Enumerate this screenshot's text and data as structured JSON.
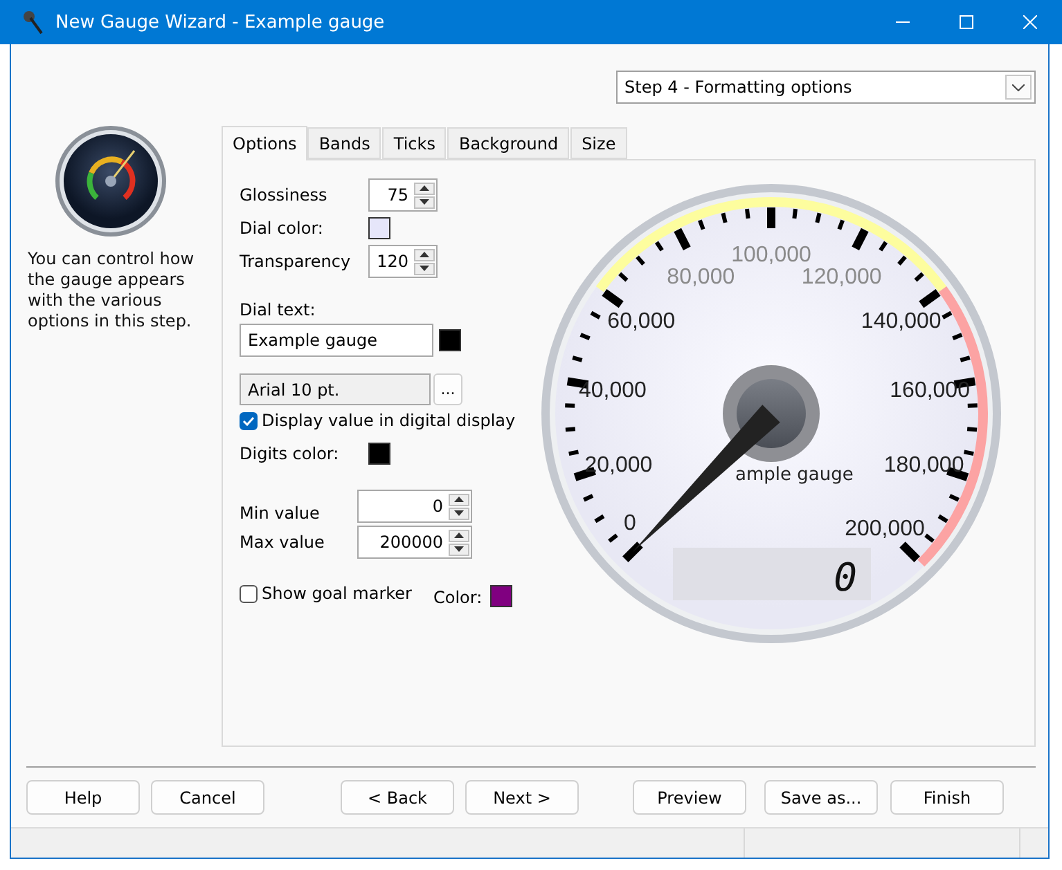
{
  "window": {
    "title": "New Gauge Wizard - Example gauge"
  },
  "step_select": {
    "value": "Step 4 - Formatting options"
  },
  "description": "You can control how the gauge appears with the various options in this step.",
  "tabs": [
    {
      "label": "Options",
      "selected": true
    },
    {
      "label": "Bands",
      "selected": false
    },
    {
      "label": "Ticks",
      "selected": false
    },
    {
      "label": "Background",
      "selected": false
    },
    {
      "label": "Size",
      "selected": false
    }
  ],
  "options": {
    "glossiness": {
      "label": "Glossiness",
      "value": "75"
    },
    "dial_color": {
      "label": "Dial color:",
      "color": "#e6e6fa"
    },
    "transparency": {
      "label": "Transparency",
      "value": "120"
    },
    "dial_text": {
      "label": "Dial text:",
      "value": "Example gauge",
      "color": "#000000"
    },
    "font": {
      "value": "Arial 10 pt.",
      "button": "..."
    },
    "digital_display": {
      "label": "Display value in digital display",
      "checked": true
    },
    "digits_color": {
      "label": "Digits color:",
      "color": "#000000"
    },
    "min_value": {
      "label": "Min value",
      "value": "0"
    },
    "max_value": {
      "label": "Max value",
      "value": "200000"
    },
    "goal_marker": {
      "label": "Show goal marker",
      "checked": false
    },
    "goal_color": {
      "label": "Color:",
      "color": "#800080"
    }
  },
  "gauge": {
    "scale_labels": [
      "0",
      "20,000",
      "40,000",
      "60,000",
      "80,000",
      "100,000",
      "120,000",
      "140,000",
      "160,000",
      "180,000",
      "200,000"
    ],
    "caption": "ample gauge",
    "reading": "0"
  },
  "buttons": [
    "Help",
    "Cancel",
    "< Back",
    "Next >",
    "Preview",
    "Save as...",
    "Finish"
  ]
}
